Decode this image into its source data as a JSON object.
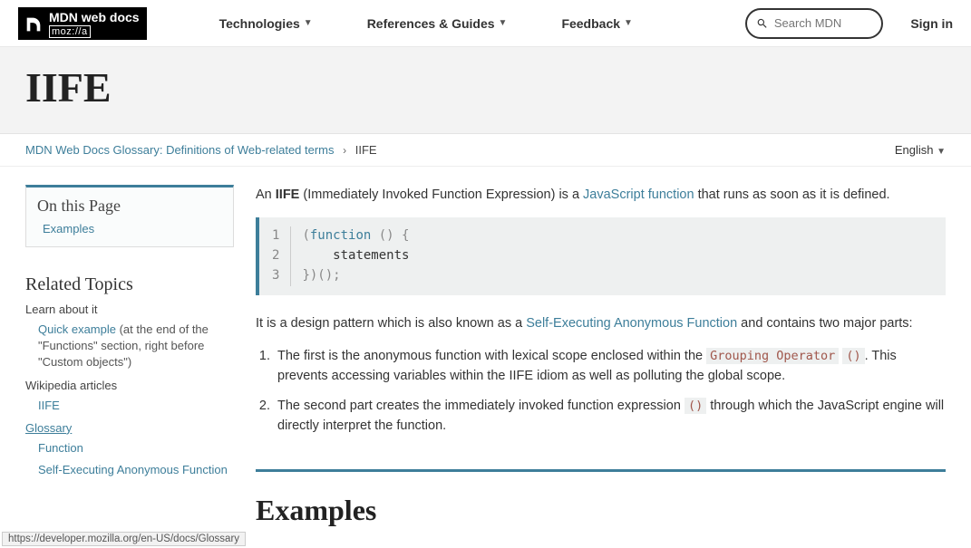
{
  "header": {
    "brand_line1": "MDN web docs",
    "brand_line2": "moz://a",
    "nav": {
      "tech": "Technologies",
      "refs": "References & Guides",
      "feedback": "Feedback"
    },
    "search_placeholder": "Search MDN",
    "signin": "Sign in"
  },
  "page_title": "IIFE",
  "crumb": {
    "parent": "MDN Web Docs Glossary: Definitions of Web-related terms",
    "current": "IIFE",
    "language": "English"
  },
  "toc": {
    "heading": "On this Page",
    "item1": "Examples"
  },
  "related": {
    "heading": "Related Topics",
    "learn_h": "Learn about it",
    "learn_link": "Quick example",
    "learn_note": " (at the end of the \"Functions\" section, right before \"Custom objects\")",
    "wiki_h": "Wikipedia articles",
    "wiki_link": "IIFE",
    "gloss_h": "Glossary",
    "gloss_link1": "Function",
    "gloss_link2": "Self-Executing Anonymous Function"
  },
  "intro": {
    "lead1": "An ",
    "bold": "IIFE",
    "lead2": " (Immediately Invoked Function Expression) is a ",
    "link": "JavaScript function",
    "lead3": " that runs as soon as it is defined."
  },
  "code": {
    "ln1": "1",
    "ln2": "2",
    "ln3": "3",
    "l1a": "(",
    "l1b": "function",
    "l1c": " () {",
    "l2": "    statements",
    "l3": "})();"
  },
  "design": {
    "pre": "It is a design pattern which is also known as a ",
    "link": "Self-Executing Anonymous Function",
    "post": " and contains two major parts:"
  },
  "parts": {
    "p1a": "The first is the anonymous function with lexical scope enclosed within the ",
    "p1code1": "Grouping Operator",
    "p1code2": "()",
    "p1b": ". This prevents accessing variables within the IIFE idiom as well as polluting the global scope.",
    "p2a": "The second part creates the immediately invoked function expression ",
    "p2code": "()",
    "p2b": " through which the JavaScript engine will directly interpret the function."
  },
  "examples_h": "Examples",
  "status_url": "https://developer.mozilla.org/en-US/docs/Glossary"
}
